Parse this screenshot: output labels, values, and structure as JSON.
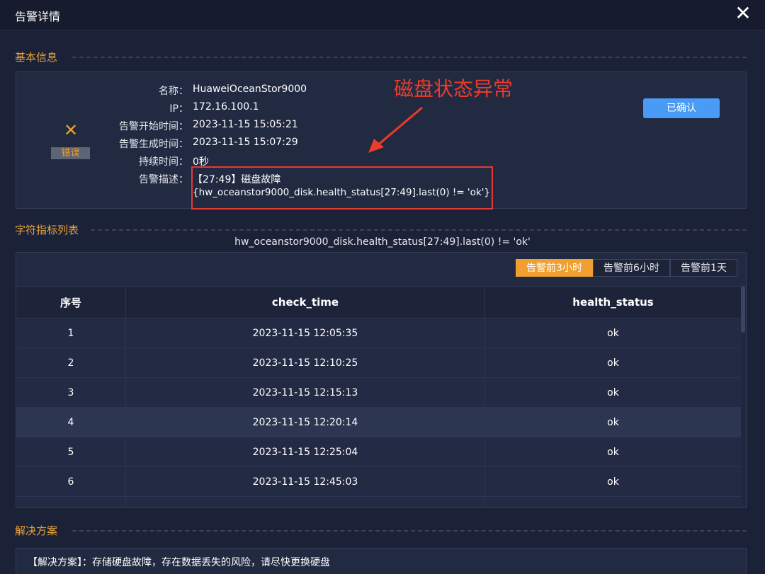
{
  "dialog": {
    "title": "告警详情",
    "close_glyph": "✕"
  },
  "basic_info": {
    "section_title": "基本信息",
    "status_icon": "close-x-icon",
    "status_badge": "错误",
    "fields": [
      {
        "label": "名称：",
        "value": "HuaweiOceanStor9000"
      },
      {
        "label": "IP：",
        "value": "172.16.100.1"
      },
      {
        "label": "告警开始时间：",
        "value": "2023-11-15 15:05:21"
      },
      {
        "label": "告警生成时间：",
        "value": "2023-11-15 15:07:29"
      },
      {
        "label": "持续时间：",
        "value": "0秒"
      },
      {
        "label": "告警描述：",
        "value": "【27:49】磁盘故障",
        "value_line2": "{hw_oceanstor9000_disk.health_status[27:49].last(0) != 'ok'}"
      }
    ],
    "confirm_button": "已确认",
    "annotation": "磁盘状态异常"
  },
  "metrics": {
    "section_title": "字符指标列表",
    "caption": "hw_oceanstor9000_disk.health_status[27:49].last(0) != 'ok'",
    "tabs": [
      {
        "label": "告警前3小时",
        "active": true
      },
      {
        "label": "告警前6小时",
        "active": false
      },
      {
        "label": "告警前1天",
        "active": false
      }
    ],
    "columns": [
      "序号",
      "check_time",
      "health_status"
    ],
    "rows": [
      [
        "1",
        "2023-11-15 12:05:35",
        "ok"
      ],
      [
        "2",
        "2023-11-15 12:10:25",
        "ok"
      ],
      [
        "3",
        "2023-11-15 12:15:13",
        "ok"
      ],
      [
        "4",
        "2023-11-15 12:20:14",
        "ok"
      ],
      [
        "5",
        "2023-11-15 12:25:04",
        "ok"
      ],
      [
        "6",
        "2023-11-15 12:45:03",
        "ok"
      ]
    ],
    "highlighted_row": 4
  },
  "solution": {
    "section_title": "解决方案",
    "text": "【解决方案】：存储硬盘故障，存在数据丢失的风险，请尽快更换硬盘"
  },
  "colors": {
    "accent": "#f0a030",
    "primary_button": "#4a9bf5",
    "annotation_red": "#e53935",
    "background": "#1b2237"
  }
}
